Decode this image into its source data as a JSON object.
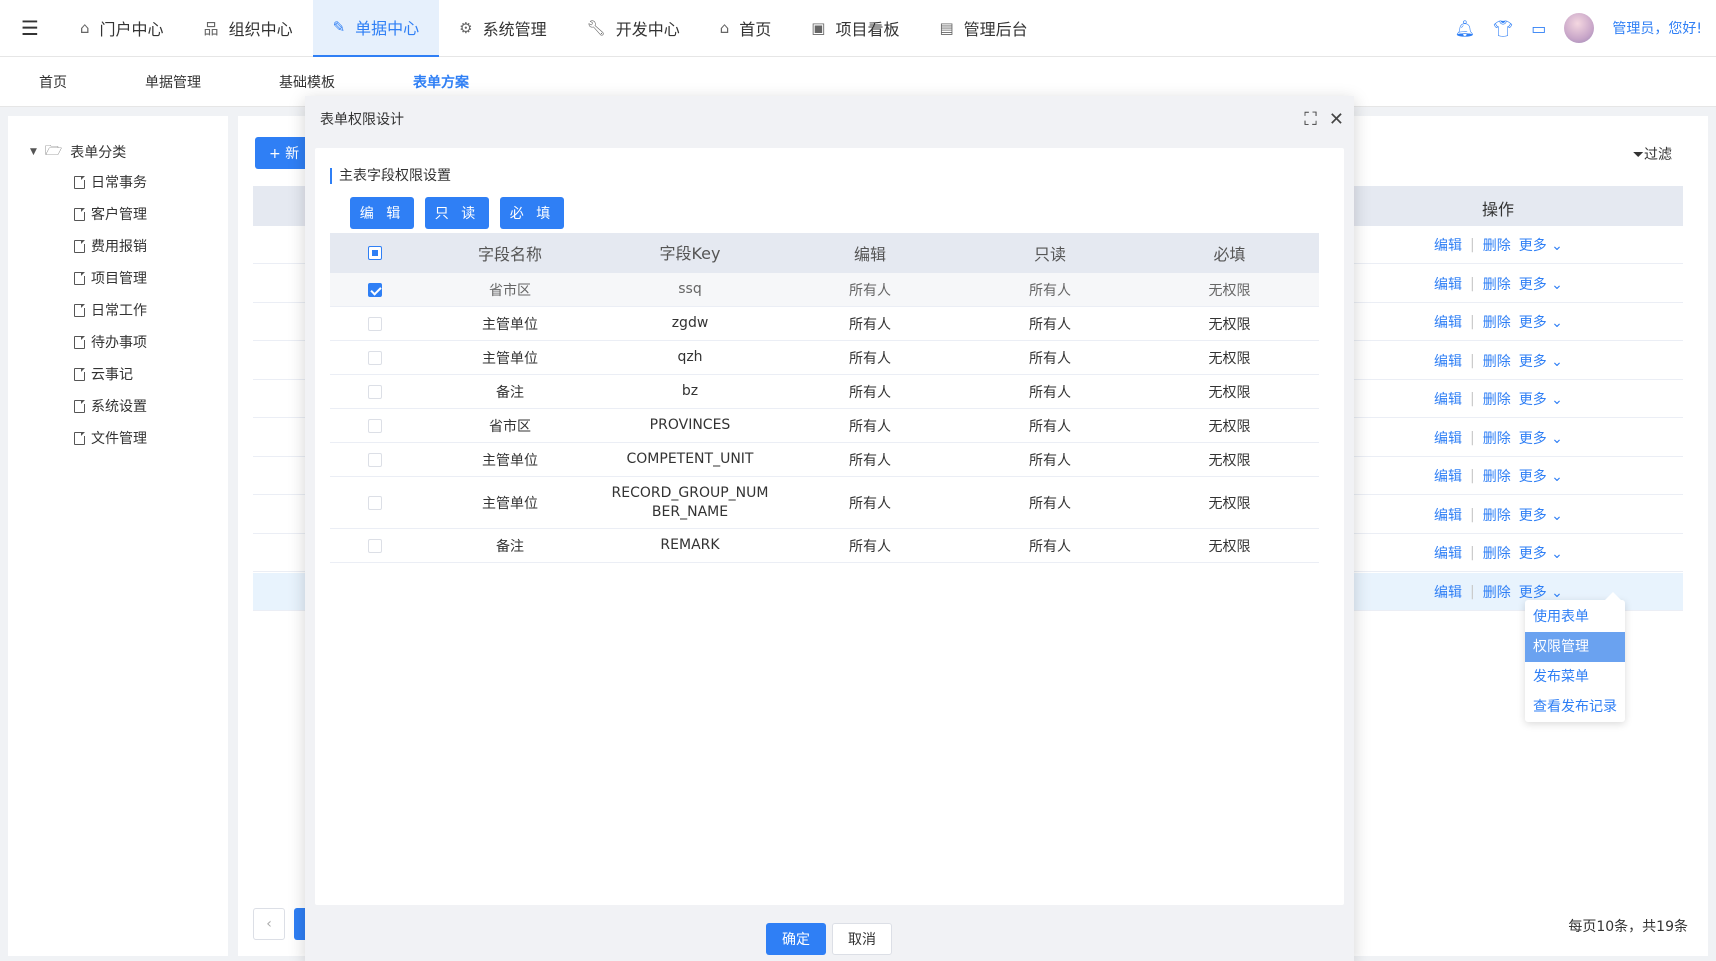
{
  "topnav": {
    "items": [
      {
        "label": "门户中心",
        "icon": "home-icon"
      },
      {
        "label": "组织中心",
        "icon": "org-icon"
      },
      {
        "label": "单据中心",
        "icon": "edit-icon"
      },
      {
        "label": "系统管理",
        "icon": "gear-icon"
      },
      {
        "label": "开发中心",
        "icon": "wrench-icon"
      },
      {
        "label": "首页",
        "icon": "home-icon"
      },
      {
        "label": "项目看板",
        "icon": "monitor-icon"
      },
      {
        "label": "管理后台",
        "icon": "admin-icon"
      }
    ],
    "active_index": 2,
    "user_greeting": "管理员，您好!"
  },
  "subtabs": [
    "首页",
    "单据管理",
    "基础模板",
    "表单方案"
  ],
  "subtab_active": 3,
  "tree": {
    "root": "表单分类",
    "items": [
      "日常事务",
      "客户管理",
      "费用报销",
      "项目管理",
      "日常工作",
      "待办事项",
      "云事记",
      "系统设置",
      "文件管理"
    ]
  },
  "main": {
    "new_button": "+ 新",
    "filter": "过滤",
    "op_header": "操作",
    "ops": {
      "edit": "编辑",
      "delete": "删除",
      "more": "更多"
    },
    "page_total": "每页10条，共19条"
  },
  "dropdown": {
    "items": [
      "使用表单",
      "权限管理",
      "发布菜单",
      "查看发布记录"
    ],
    "active_index": 1
  },
  "modal": {
    "title": "表单权限设计",
    "section_title": "主表字段权限设置",
    "buttons": [
      "编 辑",
      "只 读",
      "必 填"
    ],
    "columns": [
      "字段名称",
      "字段Key",
      "编辑",
      "只读",
      "必填"
    ],
    "rows": [
      {
        "name": "省市区",
        "key": "ssq",
        "edit": "所有人",
        "readonly": "所有人",
        "required": "无权限",
        "checked": true
      },
      {
        "name": "主管单位",
        "key": "zgdw",
        "edit": "所有人",
        "readonly": "所有人",
        "required": "无权限",
        "checked": false
      },
      {
        "name": "主管单位",
        "key": "qzh",
        "edit": "所有人",
        "readonly": "所有人",
        "required": "无权限",
        "checked": false
      },
      {
        "name": "备注",
        "key": "bz",
        "edit": "所有人",
        "readonly": "所有人",
        "required": "无权限",
        "checked": false
      },
      {
        "name": "省市区",
        "key": "PROVINCES",
        "edit": "所有人",
        "readonly": "所有人",
        "required": "无权限",
        "checked": false
      },
      {
        "name": "主管单位",
        "key": "COMPETENT_UNIT",
        "edit": "所有人",
        "readonly": "所有人",
        "required": "无权限",
        "checked": false
      },
      {
        "name": "主管单位",
        "key": "RECORD_GROUP_NUMBER_NAME",
        "key_lines": [
          "RECORD_GROUP_NUM",
          "BER_NAME"
        ],
        "edit": "所有人",
        "readonly": "所有人",
        "required": "无权限",
        "checked": false
      },
      {
        "name": "备注",
        "key": "REMARK",
        "edit": "所有人",
        "readonly": "所有人",
        "required": "无权限",
        "checked": false
      }
    ],
    "ok": "确定",
    "cancel": "取消"
  }
}
